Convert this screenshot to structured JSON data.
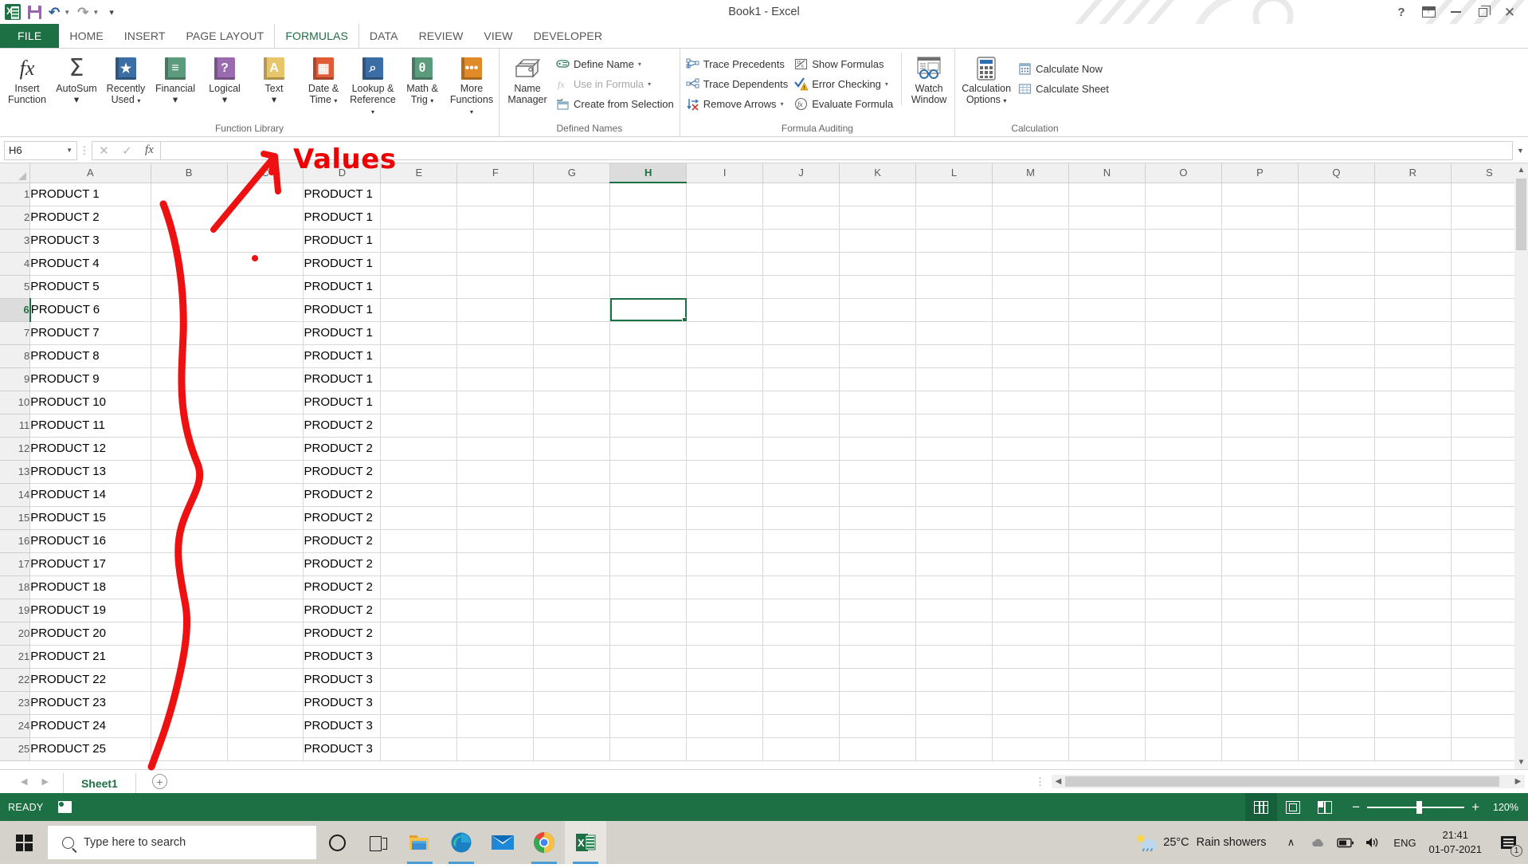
{
  "titlebar": {
    "app_title": "Book1 - Excel",
    "quick_access": [
      "save-icon",
      "undo-icon",
      "redo-icon",
      "customize-qat-icon"
    ],
    "help_label": "?",
    "minimize_label": "",
    "restore_label": "",
    "close_label": "✕"
  },
  "tabs": {
    "file": "FILE",
    "items": [
      "HOME",
      "INSERT",
      "PAGE LAYOUT",
      "FORMULAS",
      "DATA",
      "REVIEW",
      "VIEW",
      "DEVELOPER"
    ],
    "active": "FORMULAS"
  },
  "ribbon": {
    "groups": [
      {
        "label": "Function Library",
        "big_buttons": [
          {
            "line1": "Insert",
            "line2": "Function",
            "icon": "fx-icon",
            "dropdown": false
          },
          {
            "line1": "AutoSum",
            "line2": "",
            "icon": "sigma-icon",
            "dropdown": true
          },
          {
            "line1": "Recently",
            "line2": "Used",
            "icon": "star-book-icon",
            "dropdown": true
          },
          {
            "line1": "Financial",
            "line2": "",
            "icon": "coins-book-icon",
            "dropdown": true
          },
          {
            "line1": "Logical",
            "line2": "",
            "icon": "question-book-icon",
            "dropdown": true
          },
          {
            "line1": "Text",
            "line2": "",
            "icon": "text-book-icon",
            "dropdown": true
          },
          {
            "line1": "Date &",
            "line2": "Time",
            "icon": "calendar-book-icon",
            "dropdown": true
          },
          {
            "line1": "Lookup &",
            "line2": "Reference",
            "icon": "search-book-icon",
            "dropdown": true
          },
          {
            "line1": "Math &",
            "line2": "Trig",
            "icon": "theta-book-icon",
            "dropdown": true
          },
          {
            "line1": "More",
            "line2": "Functions",
            "icon": "more-book-icon",
            "dropdown": true
          }
        ]
      },
      {
        "label": "Defined Names",
        "big_buttons": [
          {
            "line1": "Name",
            "line2": "Manager",
            "icon": "name-manager-icon",
            "dropdown": false
          }
        ],
        "small_buttons": [
          {
            "label": "Define Name",
            "icon": "define-name-icon",
            "dropdown": true,
            "disabled": false
          },
          {
            "label": "Use in Formula",
            "icon": "use-in-formula-icon",
            "dropdown": true,
            "disabled": true
          },
          {
            "label": "Create from Selection",
            "icon": "create-from-selection-icon",
            "dropdown": false,
            "disabled": false
          }
        ]
      },
      {
        "label": "Formula Auditing",
        "small_buttons_col1": [
          {
            "label": "Trace Precedents",
            "icon": "trace-precedents-icon",
            "dropdown": false
          },
          {
            "label": "Trace Dependents",
            "icon": "trace-dependents-icon",
            "dropdown": false
          },
          {
            "label": "Remove Arrows",
            "icon": "remove-arrows-icon",
            "dropdown": true
          }
        ],
        "small_buttons_col2": [
          {
            "label": "Show Formulas",
            "icon": "show-formulas-icon",
            "dropdown": false
          },
          {
            "label": "Error Checking",
            "icon": "error-checking-icon",
            "dropdown": true
          },
          {
            "label": "Evaluate Formula",
            "icon": "evaluate-formula-icon",
            "dropdown": false
          }
        ],
        "big_buttons": [
          {
            "line1": "Watch",
            "line2": "Window",
            "icon": "watch-window-icon",
            "dropdown": false
          }
        ]
      },
      {
        "label": "Calculation",
        "big_buttons": [
          {
            "line1": "Calculation",
            "line2": "Options",
            "icon": "calculation-options-icon",
            "dropdown": true
          }
        ],
        "small_buttons": [
          {
            "label": "Calculate Now",
            "icon": "calculate-now-icon",
            "dropdown": false
          },
          {
            "label": "Calculate Sheet",
            "icon": "calculate-sheet-icon",
            "dropdown": false
          }
        ]
      }
    ]
  },
  "formula_bar": {
    "name_box": "H6",
    "formula_value": "",
    "cancel_icon": "✕",
    "enter_icon": "✓",
    "insert_function_icon": "fx"
  },
  "annotation": {
    "label": "Values",
    "color": "#ee0000",
    "arrow": "curve-and-arrow"
  },
  "grid": {
    "columns": [
      "A",
      "B",
      "C",
      "D",
      "E",
      "F",
      "G",
      "H",
      "I",
      "J",
      "K",
      "L",
      "M",
      "N",
      "O",
      "P",
      "Q",
      "R",
      "S"
    ],
    "selected_column": "H",
    "selected_row": 6,
    "active_cell": "H6",
    "rows": [
      {
        "n": 1,
        "A": "PRODUCT 1",
        "D": "PRODUCT 1"
      },
      {
        "n": 2,
        "A": "PRODUCT 2",
        "D": "PRODUCT 1"
      },
      {
        "n": 3,
        "A": "PRODUCT 3",
        "D": "PRODUCT 1"
      },
      {
        "n": 4,
        "A": "PRODUCT 4",
        "D": "PRODUCT 1"
      },
      {
        "n": 5,
        "A": "PRODUCT 5",
        "D": "PRODUCT 1"
      },
      {
        "n": 6,
        "A": "PRODUCT 6",
        "D": "PRODUCT 1"
      },
      {
        "n": 7,
        "A": "PRODUCT 7",
        "D": "PRODUCT 1"
      },
      {
        "n": 8,
        "A": "PRODUCT 8",
        "D": "PRODUCT 1"
      },
      {
        "n": 9,
        "A": "PRODUCT 9",
        "D": "PRODUCT 1"
      },
      {
        "n": 10,
        "A": "PRODUCT 10",
        "D": "PRODUCT 1"
      },
      {
        "n": 11,
        "A": "PRODUCT 11",
        "D": "PRODUCT 2"
      },
      {
        "n": 12,
        "A": "PRODUCT 12",
        "D": "PRODUCT 2"
      },
      {
        "n": 13,
        "A": "PRODUCT 13",
        "D": "PRODUCT 2"
      },
      {
        "n": 14,
        "A": "PRODUCT 14",
        "D": "PRODUCT 2"
      },
      {
        "n": 15,
        "A": "PRODUCT 15",
        "D": "PRODUCT 2"
      },
      {
        "n": 16,
        "A": "PRODUCT 16",
        "D": "PRODUCT 2"
      },
      {
        "n": 17,
        "A": "PRODUCT 17",
        "D": "PRODUCT 2"
      },
      {
        "n": 18,
        "A": "PRODUCT 18",
        "D": "PRODUCT 2"
      },
      {
        "n": 19,
        "A": "PRODUCT 19",
        "D": "PRODUCT 2"
      },
      {
        "n": 20,
        "A": "PRODUCT 20",
        "D": "PRODUCT 2"
      },
      {
        "n": 21,
        "A": "PRODUCT 21",
        "D": "PRODUCT 3"
      },
      {
        "n": 22,
        "A": "PRODUCT 22",
        "D": "PRODUCT 3"
      },
      {
        "n": 23,
        "A": "PRODUCT 23",
        "D": "PRODUCT 3"
      },
      {
        "n": 24,
        "A": "PRODUCT 24",
        "D": "PRODUCT 3"
      },
      {
        "n": 25,
        "A": "PRODUCT 25",
        "D": "PRODUCT 3"
      }
    ]
  },
  "sheetbar": {
    "sheets": [
      "Sheet1"
    ],
    "active_sheet": "Sheet1",
    "add_sheet_label": "+"
  },
  "statusbar": {
    "mode": "READY",
    "views": [
      "normal-view",
      "page-layout-view",
      "page-break-view"
    ],
    "active_view": "normal-view",
    "zoom_minus": "−",
    "zoom_plus": "+",
    "zoom_level": "120%"
  },
  "taskbar": {
    "search_placeholder": "Type here to search",
    "apps": [
      "cortana-icon",
      "task-view-icon",
      "file-explorer-icon",
      "edge-icon",
      "mail-icon",
      "chrome-icon",
      "excel-icon"
    ],
    "weather_temp": "25°C",
    "weather_desc": "Rain showers",
    "language": "ENG",
    "time": "21:41",
    "date": "01-07-2021",
    "notification_count": "1"
  }
}
